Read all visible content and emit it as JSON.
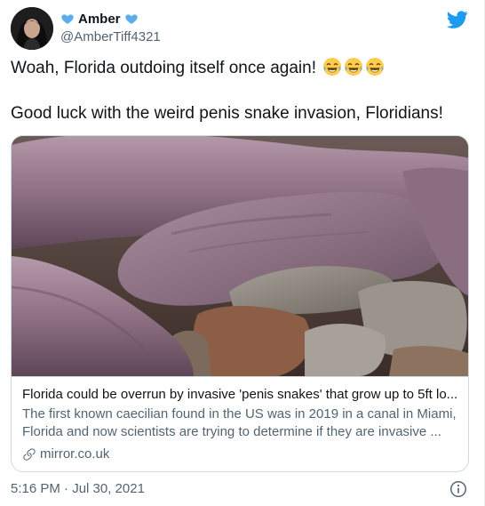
{
  "author": {
    "display_name": "Amber",
    "handle": "@AmberTiff4321"
  },
  "tweet": {
    "line1": "Woah, Florida outdoing itself once again!",
    "line1_emojis": [
      "tears-of-joy-emoji",
      "tears-of-joy-emoji",
      "tears-of-joy-emoji"
    ],
    "line2": "Good luck with the weird penis snake invasion, Floridians!",
    "timestamp": "5:16 PM · Jul 30, 2021"
  },
  "card": {
    "title": "Florida could be overrun by invasive 'penis snakes' that grow up to 5ft lo...",
    "description": "The first known caecilian found in the US was in 2019 in a canal in Miami, Florida and now scientists are trying to determine if they are invasive ...",
    "domain": "mirror.co.uk"
  },
  "colors": {
    "twitter_blue": "#1d9bf0",
    "text_primary": "#0f1419",
    "text_secondary": "#536471",
    "border": "#cfd9de"
  },
  "icons": {
    "brand": "twitter-bird-icon",
    "name_decoration": "blue-heart-icon",
    "card_link": "link-icon",
    "info": "info-icon"
  }
}
